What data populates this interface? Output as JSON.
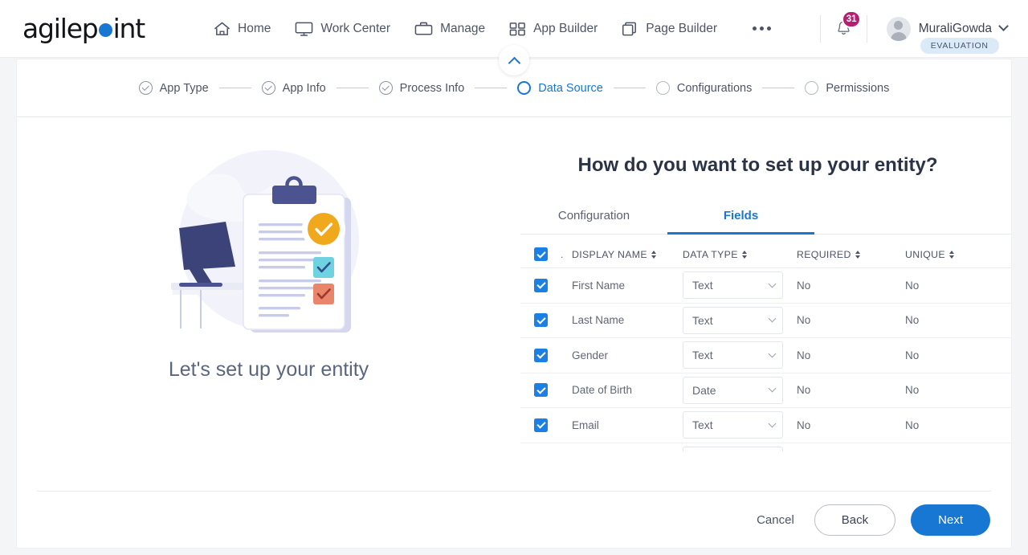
{
  "brand": {
    "name_part1": "agilep",
    "name_part2": "int",
    "accent": "#1877d2"
  },
  "topnav": {
    "items": [
      {
        "label": "Home",
        "icon": "home-icon"
      },
      {
        "label": "Work Center",
        "icon": "monitor-icon"
      },
      {
        "label": "Manage",
        "icon": "briefcase-icon"
      },
      {
        "label": "App Builder",
        "icon": "grid-icon"
      },
      {
        "label": "Page Builder",
        "icon": "copy-icon"
      }
    ],
    "more_label": "more-options",
    "notifications": {
      "count": "31",
      "icon": "bell-icon",
      "badge_color": "#b61f70"
    },
    "user": {
      "name": "MuraliGowda",
      "plan_badge": "EVALUATION"
    }
  },
  "collapse_button": {
    "icon": "chevron-up-icon"
  },
  "stepper": {
    "steps": [
      {
        "label": "App Type",
        "state": "done"
      },
      {
        "label": "App Info",
        "state": "done"
      },
      {
        "label": "Process Info",
        "state": "done"
      },
      {
        "label": "Data Source",
        "state": "active"
      },
      {
        "label": "Configurations",
        "state": "pending"
      },
      {
        "label": "Permissions",
        "state": "pending"
      }
    ]
  },
  "left_pane": {
    "caption": "Let's set up your entity",
    "illustration": "desk-clipboard-checklist-illustration"
  },
  "main": {
    "heading": "How do you want to set up your entity?",
    "tabs": [
      {
        "label": "Configuration",
        "active": false
      },
      {
        "label": "Fields",
        "active": true
      }
    ]
  },
  "table": {
    "select_all_checked": true,
    "index_header": ".",
    "columns": [
      {
        "label": "DISPLAY NAME",
        "sortable": true
      },
      {
        "label": "DATA TYPE",
        "sortable": true
      },
      {
        "label": "REQUIRED",
        "sortable": true
      },
      {
        "label": "UNIQUE",
        "sortable": true
      }
    ],
    "rows": [
      {
        "checked": true,
        "display_name": "First Name",
        "data_type": "Text",
        "required": "No",
        "unique": "No"
      },
      {
        "checked": true,
        "display_name": "Last Name",
        "data_type": "Text",
        "required": "No",
        "unique": "No"
      },
      {
        "checked": true,
        "display_name": "Gender",
        "data_type": "Text",
        "required": "No",
        "unique": "No"
      },
      {
        "checked": true,
        "display_name": "Date of Birth",
        "data_type": "Date",
        "required": "No",
        "unique": "No"
      },
      {
        "checked": true,
        "display_name": "Email",
        "data_type": "Text",
        "required": "No",
        "unique": "No"
      }
    ],
    "scrollbar": {
      "thumb_position": "top"
    }
  },
  "footer": {
    "cancel_label": "Cancel",
    "back_label": "Back",
    "next_label": "Next"
  }
}
